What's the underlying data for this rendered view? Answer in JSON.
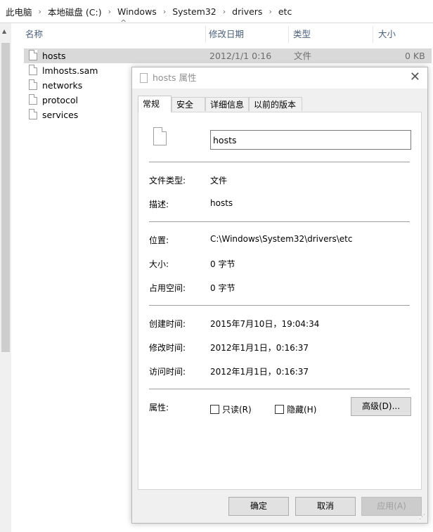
{
  "breadcrumb": [
    "此电脑",
    "本地磁盘 (C:)",
    "Windows",
    "System32",
    "drivers",
    "etc"
  ],
  "columns": {
    "name": "名称",
    "date": "修改日期",
    "type": "类型",
    "size": "大小"
  },
  "files": [
    {
      "name": "hosts",
      "date": "2012/1/1 0:16",
      "type": "文件",
      "size": "0 KB",
      "selected": true
    },
    {
      "name": "lmhosts.sam"
    },
    {
      "name": "networks"
    },
    {
      "name": "protocol"
    },
    {
      "name": "services"
    }
  ],
  "dialog": {
    "title": "hosts 属性",
    "tabs": [
      "常规",
      "安全",
      "详细信息",
      "以前的版本"
    ],
    "file_name": "hosts",
    "file_type_label": "文件类型:",
    "file_type": "文件",
    "desc_label": "描述:",
    "desc": "hosts",
    "location_label": "位置:",
    "location": "C:\\Windows\\System32\\drivers\\etc",
    "size_label": "大小:",
    "size": "0 字节",
    "disk_size_label": "占用空间:",
    "disk_size": "0 字节",
    "created_label": "创建时间:",
    "created": "2015年7月10日，19:04:34",
    "modified_label": "修改时间:",
    "modified": "2012年1月1日，0:16:37",
    "accessed_label": "访问时间:",
    "accessed": "2012年1月1日，0:16:37",
    "attrs_label": "属性:",
    "readonly_label": "只读(R)",
    "hidden_label": "隐藏(H)",
    "advanced_label": "高级(D)...",
    "ok_label": "确定",
    "cancel_label": "取消",
    "apply_label": "应用(A)"
  }
}
